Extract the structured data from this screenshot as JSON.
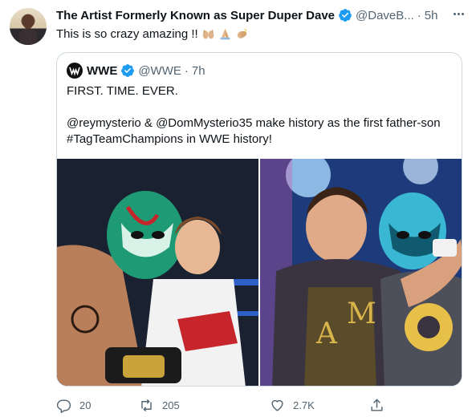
{
  "tweet": {
    "display_name": "The Artist Formerly Known as Super Duper Dave",
    "handle": "@DaveB...",
    "separator": "·",
    "time": "5h",
    "text": "This is so crazy amazing !!",
    "emojis": [
      "raising-hands-emoji",
      "folded-hands-emoji",
      "clapping-hands-emoji"
    ],
    "icons": {
      "verified": "verified-badge-icon",
      "more": "more-options-icon"
    }
  },
  "quote": {
    "display_name": "WWE",
    "handle": "@WWE",
    "separator": "·",
    "time": "7h",
    "lines": [
      "FIRST. TIME. EVER.",
      "@reymysterio & @DomMysterio35 make history as the first father-son",
      "#TagTeamChampions in WWE history!"
    ]
  },
  "actions": {
    "reply_count": "20",
    "retweet_count": "205",
    "like_count": "2.7K"
  },
  "colors": {
    "verified": "#1d9bf0",
    "text": "#0f1419",
    "muted": "#536471",
    "border": "#cfd9de"
  }
}
